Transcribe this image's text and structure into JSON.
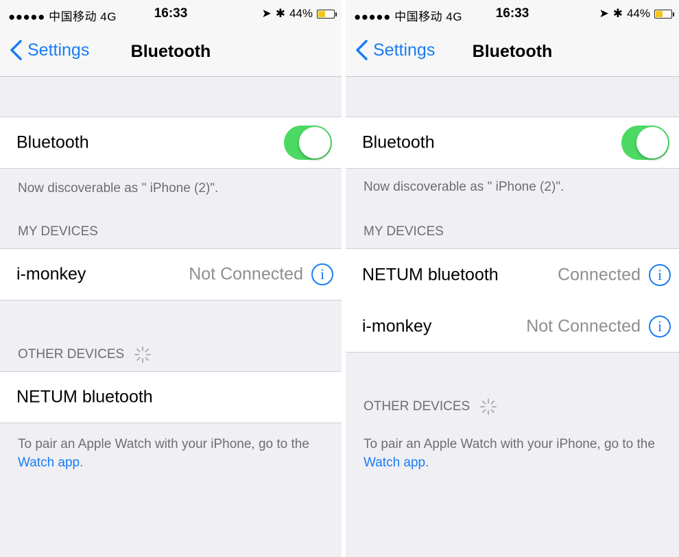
{
  "status_bar": {
    "carrier": "●●●●● 中国移动  4G",
    "time": "16:33",
    "location_glyph": "➤",
    "bt_glyph": "✱",
    "battery": "44%"
  },
  "nav": {
    "back_label": "Settings",
    "title": "Bluetooth"
  },
  "bluetooth": {
    "label": "Bluetooth",
    "enabled": true,
    "discoverable_text": "Now discoverable as \" iPhone (2)\"."
  },
  "left": {
    "my_devices_header": "MY DEVICES",
    "my_devices": [
      {
        "name": "i-monkey",
        "status": "Not Connected"
      }
    ],
    "other_devices_header": "OTHER DEVICES",
    "other_devices": [
      {
        "name": "NETUM bluetooth"
      }
    ]
  },
  "right": {
    "my_devices_header": "MY DEVICES",
    "my_devices": [
      {
        "name": "NETUM bluetooth",
        "status": "Connected"
      },
      {
        "name": "i-monkey",
        "status": "Not Connected"
      }
    ],
    "other_devices_header": "OTHER DEVICES"
  },
  "pair_note": {
    "text": "To pair an Apple Watch with your iPhone, go to the",
    "link": "Watch app",
    "suffix": "."
  },
  "icons": {
    "info_glyph": "i"
  },
  "colors": {
    "accent": "#1a7cf5",
    "toggle_on": "#4cd964",
    "battery_fill": "#f5c518"
  }
}
